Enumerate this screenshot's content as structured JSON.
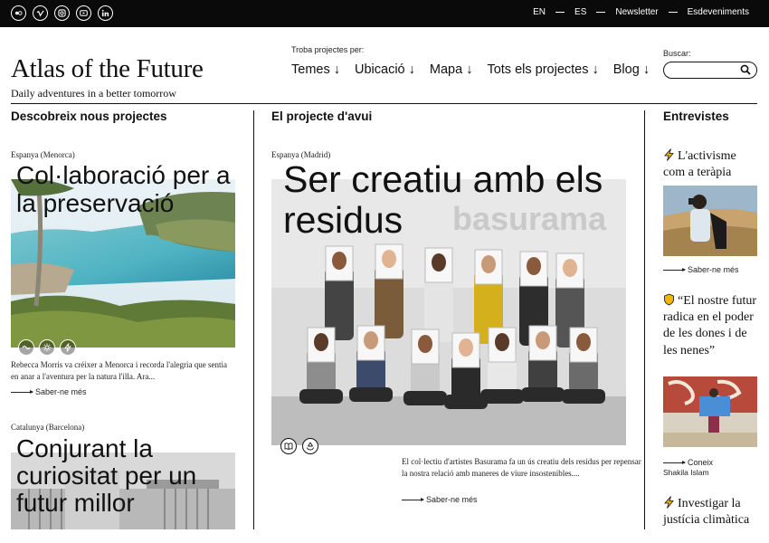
{
  "topbar": {
    "social_icons": [
      "flickr-icon",
      "vimeo-icon",
      "instagram-icon",
      "youtube-icon",
      "linkedin-icon"
    ],
    "links": [
      "EN",
      "ES",
      "Newsletter",
      "Esdeveniments"
    ]
  },
  "header": {
    "logo": "Atlas of the Future",
    "tagline": "Daily adventures in a better tomorrow",
    "nav_label": "Troba projectes per:",
    "nav": [
      "Temes ↓",
      "Ubicació ↓",
      "Mapa ↓",
      "Tots els projectes ↓",
      "Blog ↓"
    ],
    "search_label": "Buscar:",
    "search_value": ""
  },
  "columns": {
    "discover_title": "Descobreix nous projectes",
    "today_title": "El projecte d'avui",
    "interviews_title": "Entrevistes"
  },
  "discover": [
    {
      "location": "Espanya (Menorca)",
      "title": "Col·laboració per a la preservació",
      "excerpt": "Rebecca Morris va créixer a Menorca i recorda l'alegria que sentia en anar a l'aventura per la natura l'illa. Ara...",
      "more": "Saber-ne més"
    },
    {
      "location": "Catalunya (Barcelona)",
      "title": "Conjurant la curiositat per un futur millor"
    }
  ],
  "today": {
    "location": "Espanya (Madrid)",
    "title": "Ser creatiu amb els residus",
    "photo_sign": "basurama",
    "excerpt": "El col·lectiu d'artistes Basurama fa un ús creatiu dels residus per repensar la nostra relació amb maneres de viure insostenibles....",
    "more": "Saber-ne més"
  },
  "interviews": [
    {
      "title": "L'activisme com a teràpia",
      "icon": "lightning-icon",
      "more": "Saber-ne més"
    },
    {
      "title": "“El nostre futur radica en el poder de les dones i de les nenes”",
      "icon": "shield-icon",
      "caption_arrow": "Coneix",
      "caption_name": "Shakila Islam"
    },
    {
      "title": "Investigar la justícia climàtica",
      "icon": "lightning-icon"
    }
  ],
  "colors": {
    "topbar": "#0a0a0a",
    "text": "#111111",
    "bolt": "#f2b600"
  }
}
